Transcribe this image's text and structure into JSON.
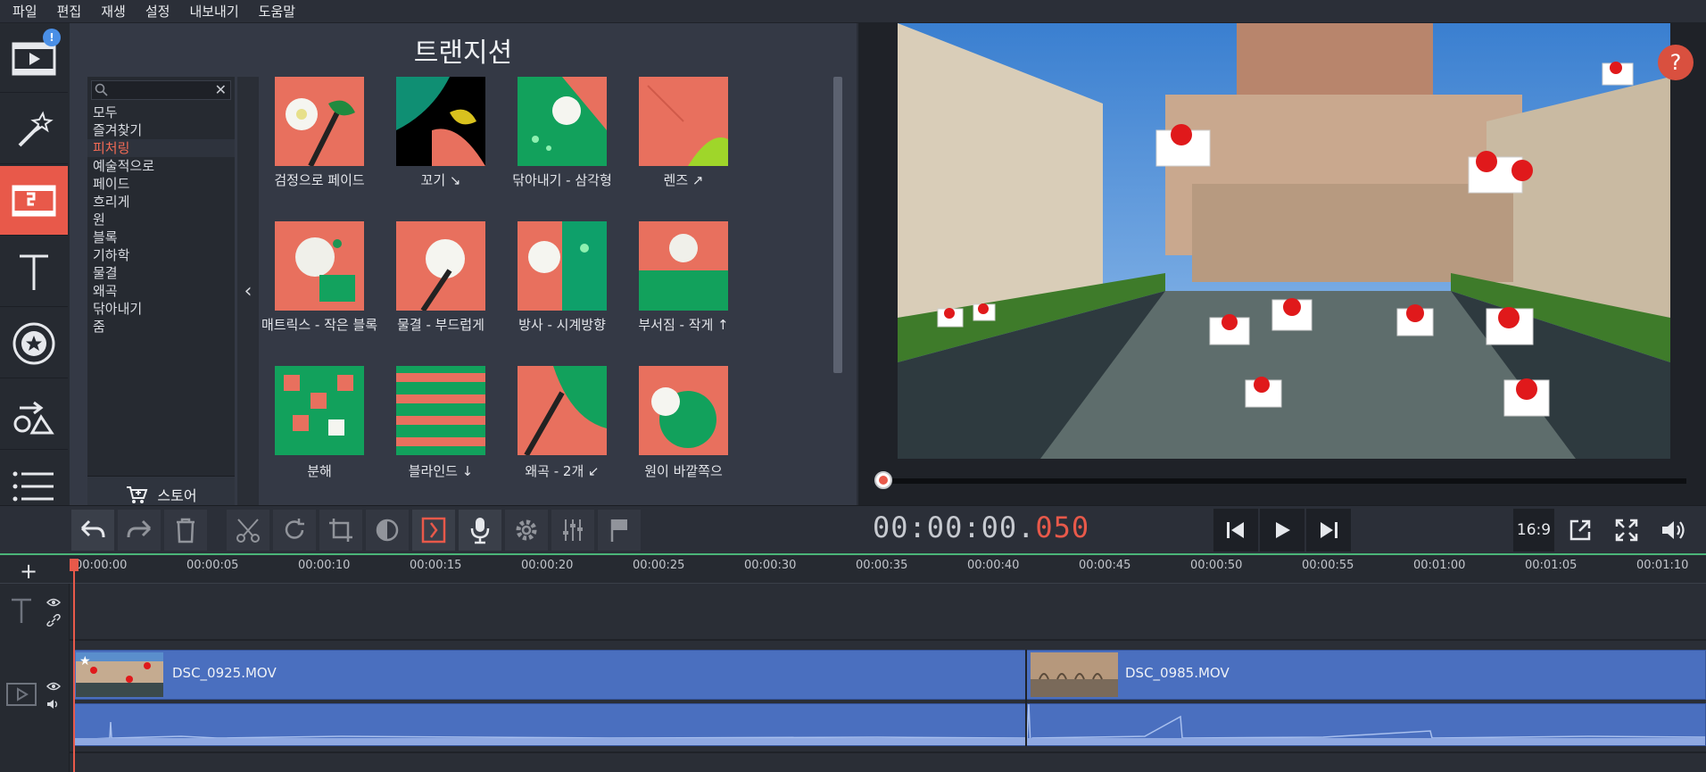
{
  "menu": [
    "파일",
    "편집",
    "재생",
    "설정",
    "내보내기",
    "도움말"
  ],
  "left_tools": {
    "badge": "!",
    "items": [
      {
        "name": "media-import-icon"
      },
      {
        "name": "filters-magic-wand-icon"
      },
      {
        "name": "transitions-icon",
        "active": true
      },
      {
        "name": "titles-icon"
      },
      {
        "name": "stickers-icon"
      },
      {
        "name": "shapes-icon"
      },
      {
        "name": "more-list-icon"
      }
    ]
  },
  "panel": {
    "title": "트랜지션",
    "search_placeholder": "",
    "categories": [
      "모두",
      "즐겨찾기",
      "피처링",
      "예술적으로",
      "페이드",
      "흐리게",
      "원",
      "블록",
      "기하학",
      "물결",
      "왜곡",
      "닦아내기",
      "줌"
    ],
    "selected_category": "피처링",
    "store_label": "스토어",
    "transitions": [
      {
        "label": "검정으로 페이드"
      },
      {
        "label": "꼬기 ↘"
      },
      {
        "label": "닦아내기 - 삼각형"
      },
      {
        "label": "렌즈 ↗"
      },
      {
        "label": "매트릭스 - 작은 블록"
      },
      {
        "label": "물결 - 부드럽게"
      },
      {
        "label": "방사 - 시계방향"
      },
      {
        "label": "부서짐 - 작게 ↑"
      },
      {
        "label": "분해"
      },
      {
        "label": "블라인드 ↓"
      },
      {
        "label": "왜곡 - 2개 ↙"
      },
      {
        "label": "원이 바깥쪽으"
      }
    ]
  },
  "preview": {
    "help": "?",
    "aspect": "16:9"
  },
  "timecode": {
    "main": "00:00:00.",
    "ms": "050"
  },
  "ruler": [
    "00:00:00",
    "00:00:05",
    "00:00:10",
    "00:00:15",
    "00:00:20",
    "00:00:25",
    "00:00:30",
    "00:00:35",
    "00:00:40",
    "00:00:45",
    "00:00:50",
    "00:00:55",
    "00:01:00",
    "00:01:05",
    "00:01:10"
  ],
  "clips": [
    {
      "name": "DSC_0925.MOV"
    },
    {
      "name": "DSC_0985.MOV"
    }
  ],
  "colors": {
    "accent": "#e8594a",
    "clip": "#4a6fbf",
    "panel": "#343945"
  }
}
